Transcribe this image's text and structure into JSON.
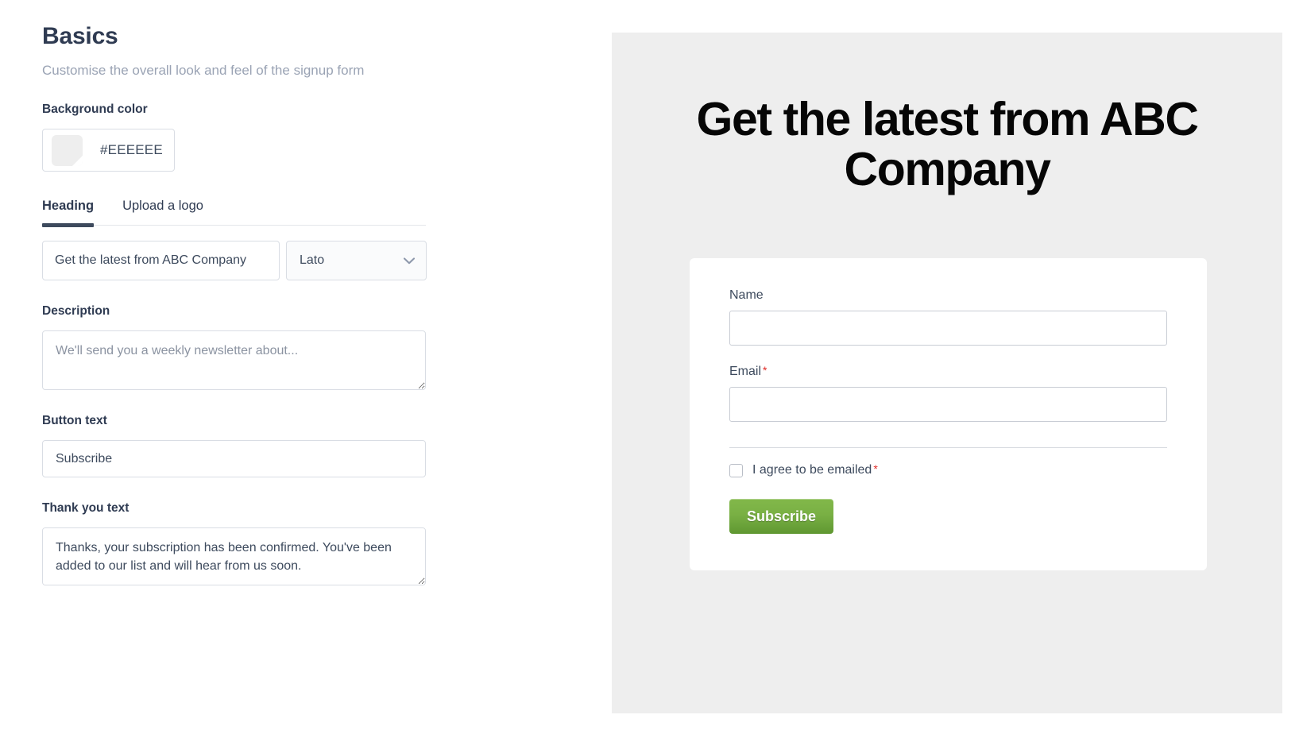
{
  "editor": {
    "title": "Basics",
    "subtitle": "Customise the overall look and feel of the signup form",
    "background_color": {
      "label": "Background color",
      "value": "#EEEEEE",
      "swatch_color": "#EEEEEE"
    },
    "tabs": [
      {
        "label": "Heading",
        "active": true
      },
      {
        "label": "Upload a logo",
        "active": false
      }
    ],
    "heading": {
      "value": "Get the latest from ABC Company",
      "placeholder": "Heading"
    },
    "font_select": {
      "value": "Lato",
      "icon": "chevron-down-icon"
    },
    "description": {
      "label": "Description",
      "value": "",
      "placeholder": "We'll send you a weekly newsletter about..."
    },
    "button_text": {
      "label": "Button text",
      "value": "Subscribe",
      "placeholder": "Button text"
    },
    "thank_you_text": {
      "label": "Thank you text",
      "value": "Thanks, your subscription has been confirmed. You've been added to our list and will hear from us soon.",
      "placeholder": "Thank you text"
    }
  },
  "preview": {
    "background_color": "#EEEEEE",
    "heading": "Get the latest from ABC Company",
    "card": {
      "name_field": {
        "label": "Name",
        "required": false,
        "value": "",
        "placeholder": ""
      },
      "email_field": {
        "label": "Email",
        "required": true,
        "required_marker": "*",
        "value": "",
        "placeholder": ""
      },
      "consent": {
        "label": "I agree to be emailed",
        "required_marker": "*",
        "checked": false
      },
      "submit_button": {
        "label": "Subscribe",
        "color": "#79b044"
      }
    }
  }
}
